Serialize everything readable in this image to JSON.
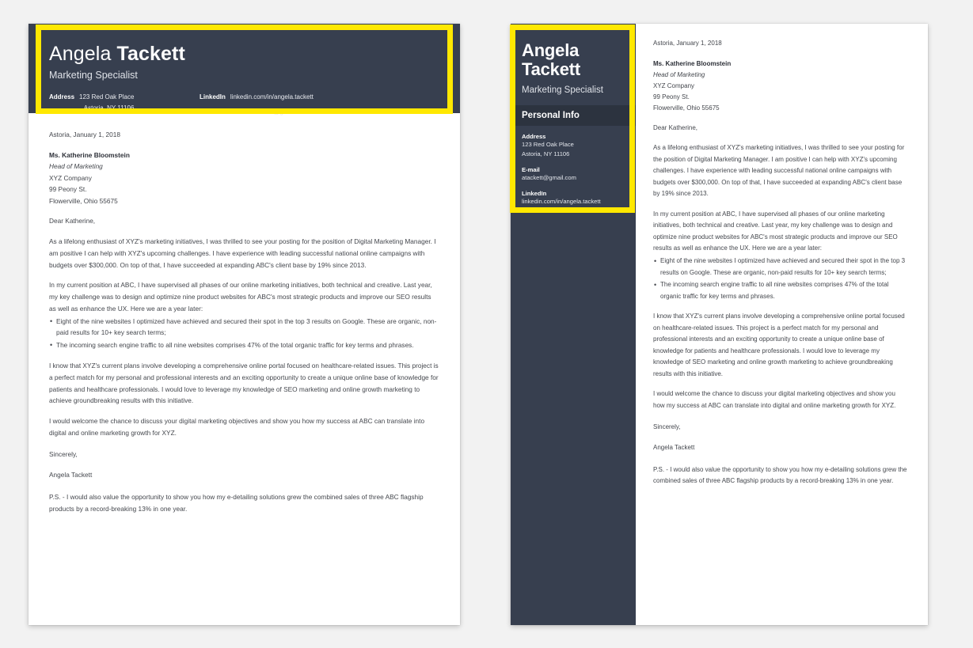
{
  "theme": {
    "page_background": "#f2f2f2",
    "paper": "#ffffff",
    "dark_panel": "#373f4f",
    "dark_panel_accent": "#2c333f",
    "highlight_yellow": "#ffe800",
    "body_text": "#44474d"
  },
  "person": {
    "first_name": "Angela",
    "last_name": "Tackett",
    "job_title": "Marketing Specialist"
  },
  "contact": {
    "address_label": "Address",
    "address_line1": "123 Red Oak Place",
    "address_line2": "Astoria, NY 11106",
    "linkedin_label": "LinkedIn",
    "linkedin_value": "linkedin.com/in/angela.tackett",
    "email_label": "E-mail",
    "email_value": "atackett@gmail.com"
  },
  "sidebar": {
    "section_title": "Personal Info"
  },
  "letter": {
    "date": "Astoria, January 1, 2018",
    "recipient_name": "Ms. Katherine Bloomstein",
    "recipient_role": "Head of Marketing",
    "recipient_company": "XYZ Company",
    "recipient_street": "99 Peony St.",
    "recipient_city": "Flowerville, Ohio 55675",
    "salutation": "Dear Katherine,",
    "paragraph_1": "As a lifelong enthusiast of XYZ's marketing initiatives, I was thrilled to see your posting for the position of Digital Marketing Manager. I am positive I can help with XYZ's upcoming challenges. I have experience with leading successful national online campaigns with budgets over $300,000. On top of that, I have succeeded at expanding ABC's client base by 19% since 2013.",
    "paragraph_2": "In my current position at ABC, I have supervised all phases of our online marketing initiatives, both technical and creative. Last year, my key challenge was to design and optimize nine product websites for ABC's most strategic products and improve our SEO results as well as enhance the UX. Here we are a year later:",
    "bullet_1": "Eight of the nine websites I optimized have achieved and secured their spot in the top 3 results on Google. These are organic, non-paid results for 10+ key search terms;",
    "bullet_2": "The incoming search engine traffic to all nine websites comprises 47% of the total organic traffic for key terms and phrases.",
    "paragraph_3": "I know that XYZ's current plans involve developing a comprehensive online portal focused on healthcare-related issues. This project is a perfect match for my personal and professional interests and an exciting opportunity to create a unique online base of knowledge for patients and healthcare professionals. I would love to leverage my knowledge of SEO marketing and online growth marketing to achieve groundbreaking results with this initiative.",
    "paragraph_4": "I would welcome the chance to discuss your digital marketing objectives and show you how my success at ABC can translate into digital and online marketing growth for XYZ.",
    "closing": "Sincerely,",
    "signature": "Angela Tackett",
    "postscript": "P.S. - I would also value the opportunity to show you how my e-detailing solutions grew the combined sales of three ABC flagship products by a record-breaking 13% in one year."
  }
}
